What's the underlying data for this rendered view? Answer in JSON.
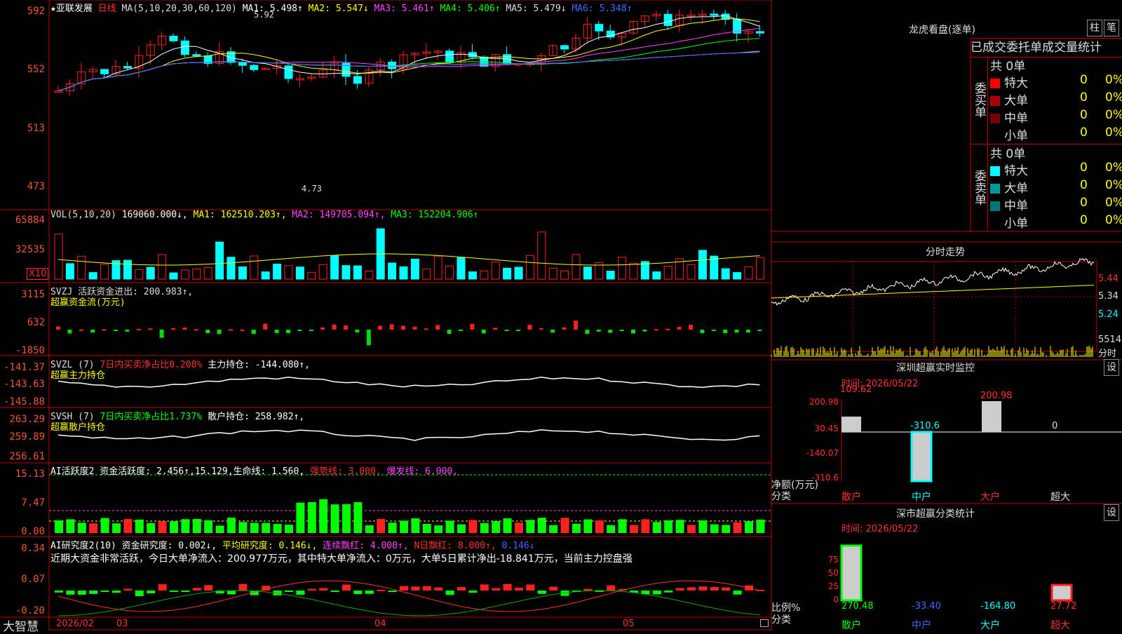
{
  "stock_title": "★亚联发展",
  "period": "日线",
  "ma_header": {
    "label": "MA(5,10,20,30,60,120)",
    "items": [
      {
        "label": "MA1: 5.498↑",
        "color": "#ffffff"
      },
      {
        "label": "MA2: 5.547↓",
        "color": "#ffff00"
      },
      {
        "label": "MA3: 5.461↑",
        "color": "#ff44ff"
      },
      {
        "label": "MA4: 5.406↑",
        "color": "#00ff00"
      },
      {
        "label": "MA5: 5.479↓",
        "color": "#dddddd"
      },
      {
        "label": "MA6: 5.348↑",
        "color": "#4466ff"
      }
    ]
  },
  "price_axis": [
    "592",
    "552",
    "513",
    "473"
  ],
  "price_marks": {
    "high": "5.92",
    "low": "4.73"
  },
  "vol_header": {
    "label": "VOL(5,10,20)",
    "value": "169060.000↓,",
    "items": [
      {
        "label": "MA1: 162510.203↑,",
        "color": "#ffff00"
      },
      {
        "label": "MA2: 149705.094↑,",
        "color": "#ff44ff"
      },
      {
        "label": "MA3: 152204.906↑",
        "color": "#00ff00"
      }
    ]
  },
  "vol_axis": [
    "65884",
    "32535"
  ],
  "vol_unit": "X10",
  "svzj": {
    "line1": "SVZJ  活跃资金进出: 200.983↑,",
    "line2": "超赢资金流(万元)",
    "axis": [
      "3115",
      "632",
      "-1850"
    ]
  },
  "svzl": {
    "label": "SVZL (7) ",
    "item1": "7日内买卖净占比0.208%",
    "item2": " 主力持仓: -144.080↑,",
    "line2": "超赢主力持仓",
    "axis": [
      "-141.37",
      "-143.63",
      "-145.88"
    ]
  },
  "svsh": {
    "label": "SVSH (7) ",
    "item1": "7日内买卖净占比1.737%",
    "item2": " 散户持仓: 258.982↑,",
    "line2": "超赢散户持仓",
    "axis": [
      "263.29",
      "259.89",
      "256.61"
    ]
  },
  "ai_active": {
    "label": "AI活跃度2 资金活跃度: 2.456↑,15.129,生命线: 1.560,",
    "strong": "强势线: 3.000,",
    "burst": "爆发线: 6.000,",
    "axis": [
      "15.13",
      "7.47",
      "0.00"
    ]
  },
  "ai_research": {
    "label": "AI研究度2(10) 资金研究度: 0.002↓,",
    "avg": "平均研究度: 0.146↓,",
    "red": "连续飘红: 4.000↑,",
    "nred": "N日飘红: 8.000↑,",
    "last": "0.146↓",
    "summary": "近期大资金非常活跃，今日大单净流入：200.977万元，其中特大单净流入：0万元，大单5日累计净出-18.841万元，当前主力控盘强",
    "axis": [
      "0.34",
      "0.07",
      "-0.20"
    ]
  },
  "date_axis": [
    "2026/02",
    "03",
    "04",
    "05"
  ],
  "brand": "大智慧",
  "right": {
    "title": "龙虎看盘(逐单)",
    "btn_bar": "柱",
    "btn_pen": "笔",
    "tabs": [
      "已成交",
      "委托单",
      "成交量统计"
    ],
    "buy": {
      "side": "委买单",
      "total": "共 0单",
      "rows": [
        {
          "name": "特大",
          "count": "0",
          "pct": "0%",
          "color": "#ff0000"
        },
        {
          "name": "大单",
          "count": "0",
          "pct": "0%",
          "color": "#aa0000"
        },
        {
          "name": "中单",
          "count": "0",
          "pct": "0%",
          "color": "#770000"
        },
        {
          "name": "小单",
          "count": "0",
          "pct": "0%",
          "color": "#000000"
        }
      ]
    },
    "sell": {
      "side": "委卖单",
      "total": "共 0单",
      "rows": [
        {
          "name": "特大",
          "count": "0",
          "pct": "0%",
          "color": "#00ffff"
        },
        {
          "name": "大单",
          "count": "0",
          "pct": "0%",
          "color": "#009999"
        },
        {
          "name": "中单",
          "count": "0",
          "pct": "0%",
          "color": "#007777"
        },
        {
          "name": "小单",
          "count": "0",
          "pct": "0%",
          "color": "#000000"
        }
      ]
    },
    "intraday": {
      "title": "分时走势",
      "axis": [
        "5.44",
        "5.34",
        "5.24"
      ],
      "vol": "5514",
      "unit": "分时"
    },
    "monitor": {
      "title": "深圳超赢实时监控",
      "setting": "设",
      "time": "时间: 2026/05/22",
      "axis": [
        "200.98",
        "30.45",
        "-140.07",
        "-310.6"
      ],
      "ylabel": "净额(万元)",
      "xlabel": "分类",
      "categories": [
        "散户",
        "中户",
        "大户",
        "超大"
      ],
      "values": [
        "109.62",
        "-310.6",
        "200.98",
        "0"
      ]
    },
    "stats": {
      "title": "深市超赢分类统计",
      "setting": "设",
      "time": "时间: 2026/05/22",
      "axis": [
        "75",
        "50",
        "25",
        "0"
      ],
      "ylabel": "比例%",
      "xlabel": "分类",
      "categories": [
        "散户",
        "中户",
        "大户",
        "超大"
      ],
      "values": [
        "270.48",
        "-33.40",
        "-164.80",
        "27.72"
      ]
    }
  },
  "colors": {
    "up": "#ff2020",
    "down": "#00ffff",
    "grid": "#c00000"
  }
}
